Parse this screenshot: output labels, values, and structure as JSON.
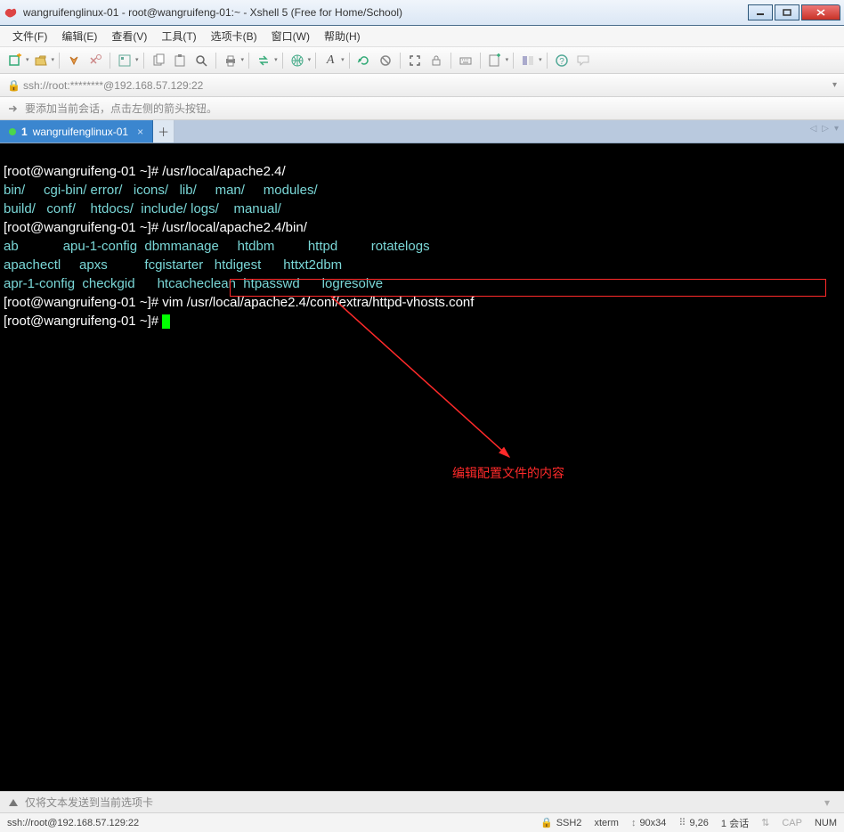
{
  "window": {
    "title": "wangruifenglinux-01 - root@wangruifeng-01:~ - Xshell 5 (Free for Home/School)"
  },
  "menu": {
    "file": "文件(F)",
    "edit": "编辑(E)",
    "view": "查看(V)",
    "tools": "工具(T)",
    "tabs": "选项卡(B)",
    "window": "窗口(W)",
    "help": "帮助(H)"
  },
  "addressbar": {
    "text": "ssh://root:********@192.168.57.129:22"
  },
  "infobar": {
    "text": "要添加当前会话，点击左侧的箭头按钮。"
  },
  "tab": {
    "index": "1",
    "label": "wangruifenglinux-01"
  },
  "terminal": {
    "prompt1": "[root@wangruifeng-01 ~]# ",
    "cmd1": "/usr/local/apache2.4/",
    "line2": "bin/     cgi-bin/ error/   icons/   lib/     man/     modules/",
    "line3": "build/   conf/    htdocs/  include/ logs/    manual/",
    "prompt2": "[root@wangruifeng-01 ~]# ",
    "cmd2": "/usr/local/apache2.4/bin/",
    "line5": "ab            apu-1-config  dbmmanage     htdbm         httpd         rotatelogs",
    "line6": "apachectl     apxs          fcgistarter   htdigest      httxt2dbm",
    "line7": "apr-1-config  checkgid      htcacheclean  htpasswd      logresolve",
    "prompt3": "[root@wangruifeng-01 ~]# ",
    "cmd3": "vim /usr/local/apache2.4/conf/extra/httpd-vhosts.conf",
    "prompt4": "[root@wangruifeng-01 ~]# "
  },
  "annotation": {
    "text": "编辑配置文件的内容"
  },
  "sendbar": {
    "placeholder": "仅将文本发送到当前选项卡"
  },
  "statusbar": {
    "conn": "ssh://root@192.168.57.129:22",
    "proto": "SSH2",
    "term": "xterm",
    "size": "90x34",
    "pos": "9,26",
    "sessions": "1 会话",
    "cap": "CAP",
    "num": "NUM"
  }
}
